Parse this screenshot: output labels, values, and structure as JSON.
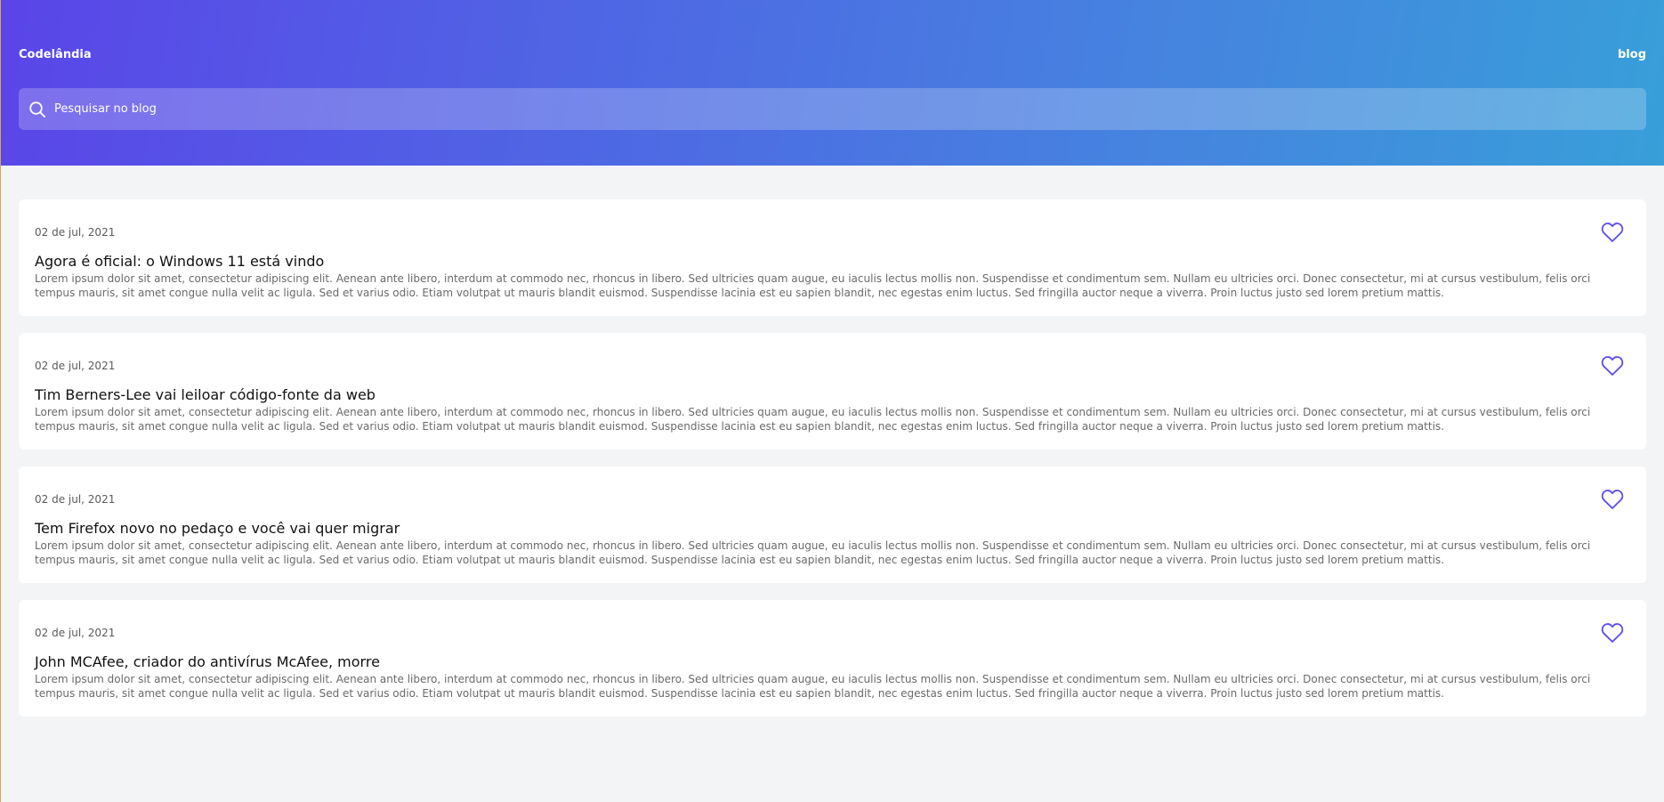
{
  "header": {
    "logo": "Codelândia",
    "nav_link": "blog",
    "gradient_start": "#5a45e8",
    "gradient_end": "#389fd9"
  },
  "search": {
    "placeholder": "Pesquisar no blog",
    "value": "",
    "icon": "search-icon"
  },
  "accent_color": "#5b4cef",
  "posts": [
    {
      "date": "02 de jul, 2021",
      "title": "Agora é oficial: o Windows 11 está vindo",
      "body": "Lorem ipsum dolor sit amet, consectetur adipiscing elit. Aenean ante libero, interdum at commodo nec, rhoncus in libero. Sed ultricies quam augue, eu iaculis lectus mollis non. Suspendisse et condimentum sem. Nullam eu ultricies orci. Donec consectetur, mi at cursus vestibulum, felis orci tempus mauris, sit amet congue nulla velit ac ligula. Sed et varius odio. Etiam volutpat ut mauris blandit euismod. Suspendisse lacinia est eu sapien blandit, nec egestas enim luctus. Sed fringilla auctor neque a viverra. Proin luctus justo sed lorem pretium mattis.",
      "icon": "heart-icon"
    },
    {
      "date": "02 de jul, 2021",
      "title": "Tim Berners-Lee vai leiloar código-fonte da web",
      "body": "Lorem ipsum dolor sit amet, consectetur adipiscing elit. Aenean ante libero, interdum at commodo nec, rhoncus in libero. Sed ultricies quam augue, eu iaculis lectus mollis non. Suspendisse et condimentum sem. Nullam eu ultricies orci. Donec consectetur, mi at cursus vestibulum, felis orci tempus mauris, sit amet congue nulla velit ac ligula. Sed et varius odio. Etiam volutpat ut mauris blandit euismod. Suspendisse lacinia est eu sapien blandit, nec egestas enim luctus. Sed fringilla auctor neque a viverra. Proin luctus justo sed lorem pretium mattis.",
      "icon": "heart-icon"
    },
    {
      "date": "02 de jul, 2021",
      "title": "Tem Firefox novo no pedaço e você vai quer migrar",
      "body": "Lorem ipsum dolor sit amet, consectetur adipiscing elit. Aenean ante libero, interdum at commodo nec, rhoncus in libero. Sed ultricies quam augue, eu iaculis lectus mollis non. Suspendisse et condimentum sem. Nullam eu ultricies orci. Donec consectetur, mi at cursus vestibulum, felis orci tempus mauris, sit amet congue nulla velit ac ligula. Sed et varius odio. Etiam volutpat ut mauris blandit euismod. Suspendisse lacinia est eu sapien blandit, nec egestas enim luctus. Sed fringilla auctor neque a viverra. Proin luctus justo sed lorem pretium mattis.",
      "icon": "heart-icon"
    },
    {
      "date": "02 de jul, 2021",
      "title": "John MCAfee, criador do antivírus McAfee, morre",
      "body": "Lorem ipsum dolor sit amet, consectetur adipiscing elit. Aenean ante libero, interdum at commodo nec, rhoncus in libero. Sed ultricies quam augue, eu iaculis lectus mollis non. Suspendisse et condimentum sem. Nullam eu ultricies orci. Donec consectetur, mi at cursus vestibulum, felis orci tempus mauris, sit amet congue nulla velit ac ligula. Sed et varius odio. Etiam volutpat ut mauris blandit euismod. Suspendisse lacinia est eu sapien blandit, nec egestas enim luctus. Sed fringilla auctor neque a viverra. Proin luctus justo sed lorem pretium mattis.",
      "icon": "heart-icon"
    }
  ]
}
